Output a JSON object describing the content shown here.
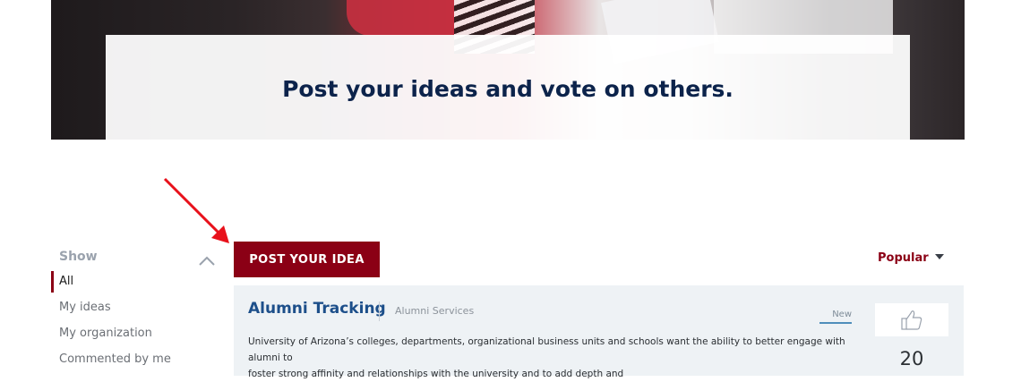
{
  "hero": {
    "headline": "Post your ideas and vote on others."
  },
  "sidebar": {
    "show_label": "Show",
    "items": [
      {
        "label": "All",
        "active": true
      },
      {
        "label": "My ideas"
      },
      {
        "label": "My organization"
      },
      {
        "label": "Commented by me"
      }
    ]
  },
  "actions": {
    "post_idea_label": "POST YOUR IDEA",
    "sort_label": "Popular"
  },
  "idea": {
    "title": "Alumni Tracking",
    "category": "Alumni Services",
    "status": "New",
    "description_line1": "University of Arizona’s colleges, departments, organizational business units and schools want the ability to better engage with alumni to",
    "description_line2": "foster strong affinity and relationships with the university and to add depth and",
    "votes": "20"
  },
  "colors": {
    "brand_red": "#8b0015",
    "navy": "#0c234b",
    "link_blue": "#1d4f8a",
    "card_bg": "#eef2f5"
  },
  "icons": [
    "collapse-chevron-up-icon",
    "thumbs-up-icon",
    "caret-down-icon",
    "annotation-arrow"
  ]
}
